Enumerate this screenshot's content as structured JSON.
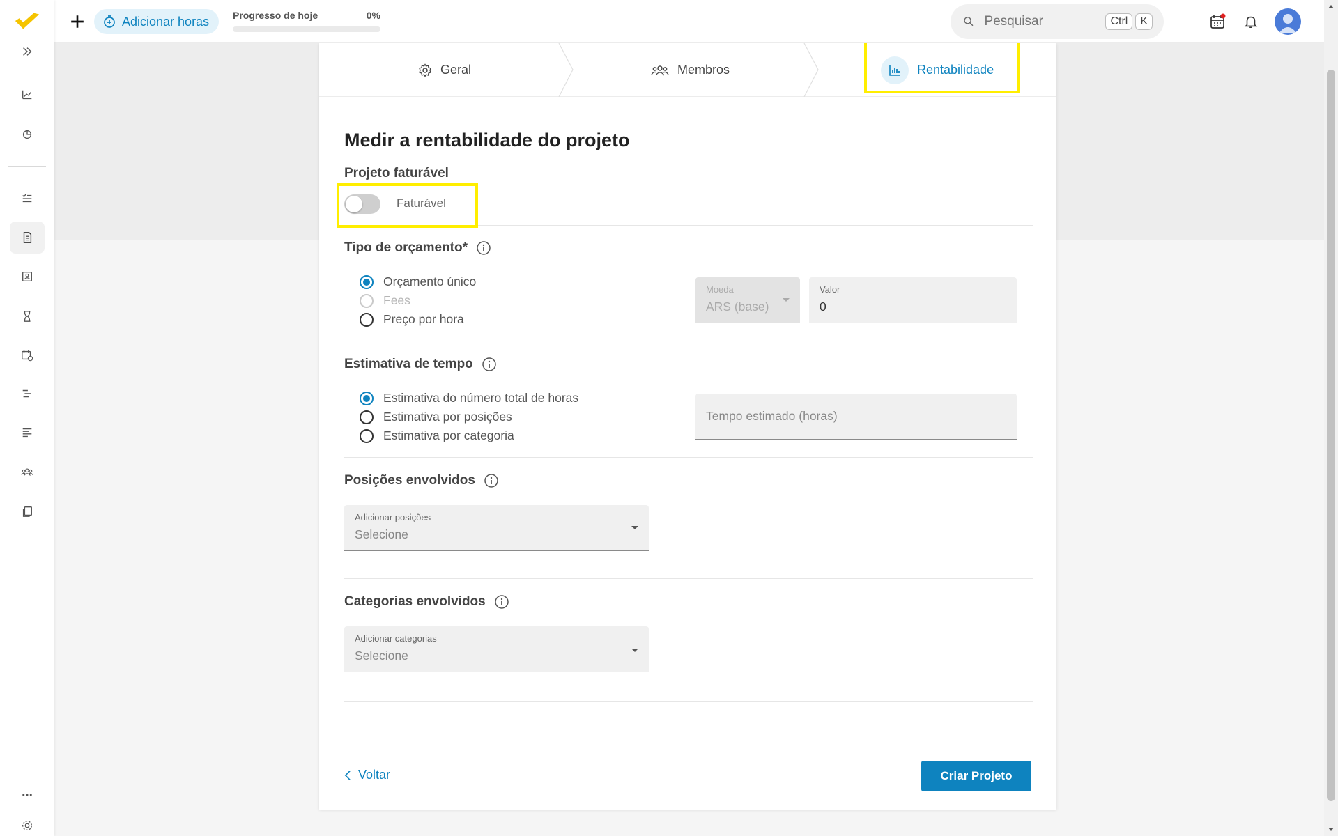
{
  "topbar": {
    "add_hours_label": "Adicionar horas",
    "progress_label": "Progresso de hoje",
    "progress_value": "0%",
    "progress_fraction": 0,
    "search_placeholder": "Pesquisar",
    "kbd_ctrl": "Ctrl",
    "kbd_k": "K"
  },
  "stepper": {
    "steps": [
      {
        "label": "Geral",
        "icon": "gear-icon"
      },
      {
        "label": "Membros",
        "icon": "users-icon"
      },
      {
        "label": "Rentabilidade",
        "icon": "bar-chart-icon"
      }
    ],
    "active_index": 2
  },
  "form": {
    "title": "Medir a rentabilidade do projeto",
    "billable": {
      "section_label": "Projeto faturável",
      "toggle_label": "Faturável",
      "enabled": false
    },
    "budget": {
      "section_label": "Tipo de orçamento*",
      "options": [
        "Orçamento único",
        "Fees",
        "Preço por hora"
      ],
      "selected": "Orçamento único",
      "disabled_options": [
        "Fees"
      ],
      "currency_label": "Moeda",
      "currency_value": "ARS (base)",
      "value_label": "Valor",
      "value": "0"
    },
    "time_estimate": {
      "section_label": "Estimativa de tempo",
      "options": [
        "Estimativa do número total de horas",
        "Estimativa por posições",
        "Estimativa por categoria"
      ],
      "selected": "Estimativa do número total de horas",
      "hours_placeholder": "Tempo estimado (horas)"
    },
    "positions": {
      "section_label": "Posições envolvidos",
      "field_label": "Adicionar posições",
      "placeholder": "Selecione"
    },
    "categories": {
      "section_label": "Categorias envolvidos",
      "field_label": "Adicionar categorias",
      "placeholder": "Selecione"
    }
  },
  "footer": {
    "back_label": "Voltar",
    "create_label": "Criar Projeto"
  },
  "colors": {
    "accent": "#0e83bf",
    "highlight": "#ffee00",
    "logo": "#f5c400"
  }
}
